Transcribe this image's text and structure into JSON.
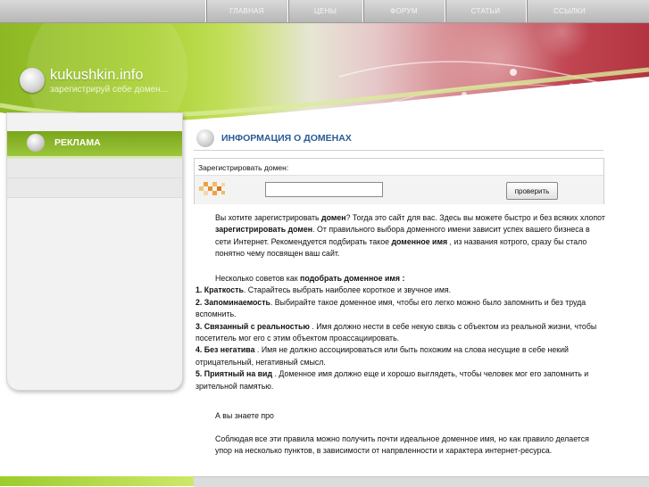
{
  "nav": [
    "ГЛАВНАЯ",
    "ЦЕНЫ",
    "ФОРУМ",
    "СТАТЬИ",
    "ССЫЛКИ"
  ],
  "header": {
    "title": "kukushkin.info",
    "subtitle": "зарегистрируй себе домен..."
  },
  "sidebar": {
    "title": "РЕКЛАМА"
  },
  "content": {
    "title": "ИНФОРМАЦИЯ О ДОМЕНАХ",
    "register_label": "Зарегистрировать домен:",
    "input_value": "",
    "check_button": "проверить",
    "p1_a": "Вы хотите зарегистрировать ",
    "p1_b": "домен",
    "p1_c": "? Тогда это сайт для вас. Здесь вы можете быстро и без всяких хлопот ",
    "p1_d": "зарегистрировать домен",
    "p1_e": ". От правильного выбора доменного имени зависит успех вашего бизнеса в сети Интернет. Рекомендуется подбирать такое ",
    "p1_f": "доменное имя",
    "p1_g": " , из названия котрого, сразу бы стало понятно чему посвящен ваш сайт.",
    "p2_a": "Несколько советов как ",
    "p2_b": "подобрать доменное имя :",
    "tips": [
      {
        "t": "1. Краткость",
        "d": ". Старайтесь выбрать наиболее короткое и звучное имя."
      },
      {
        "t": "2. Запоминаемость",
        "d": ". Выбирайте такое доменное имя, чтобы его легко можно было запомнить и без труда вспомнить."
      },
      {
        "t": "3. Связанный с реальностью",
        "d": " . Имя должно нести в себе некую связь с объектом из реальной жизни, чтобы посетитель мог его с этим объектом проассациировать."
      },
      {
        "t": "4. Без негатива",
        "d": " . Имя не должно ассоциироваться или быть похожим на слова несущие в себе некий отрицательный, негативный смысл."
      },
      {
        "t": "5. Приятный на вид",
        "d": " . Доменное имя должно еще и хорошо выглядеть, чтобы человек мог его запомнить и зрительной памятью."
      }
    ],
    "p3": "А вы знаете про",
    "p4": "Соблюдая все эти правила можно получить почти идеальное доменное имя, но как правило делается упор на несколько пунктов,    в зависимости от напрвленности и характера интернет-ресурса."
  }
}
